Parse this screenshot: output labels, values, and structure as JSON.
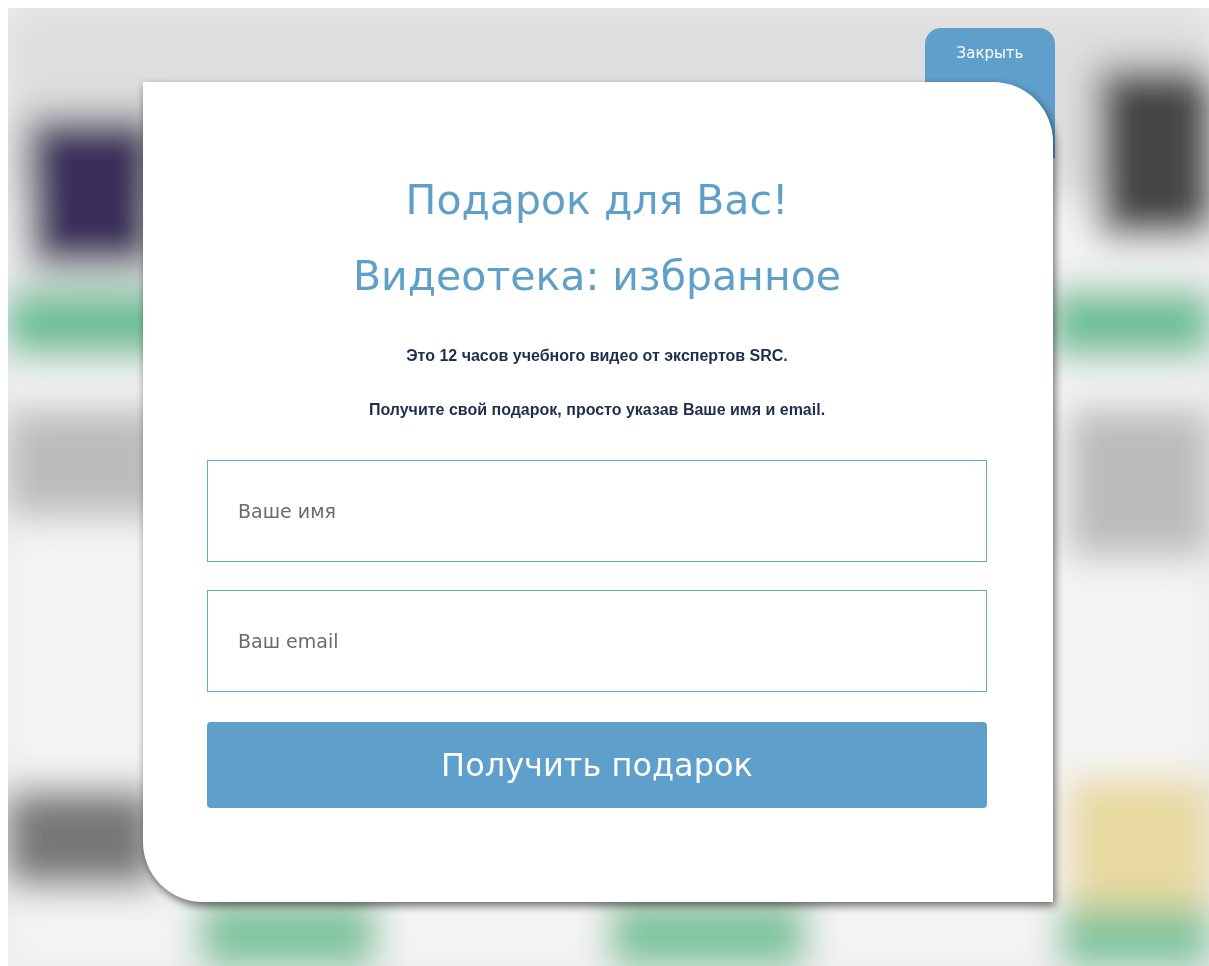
{
  "close_button": {
    "label": "Закрыть"
  },
  "modal": {
    "title_lines": [
      "Подарок для Вас!",
      "Видеотека: избранное"
    ],
    "paragraphs": [
      "Это 12 часов учебного видео от экспертов SRC.",
      "Получите свой подарок, просто указав Ваше имя и email."
    ],
    "fields": [
      {
        "placeholder": "Ваше имя"
      },
      {
        "placeholder": "Ваш email"
      }
    ],
    "submit_button": {
      "label": "Получить подарок"
    }
  }
}
